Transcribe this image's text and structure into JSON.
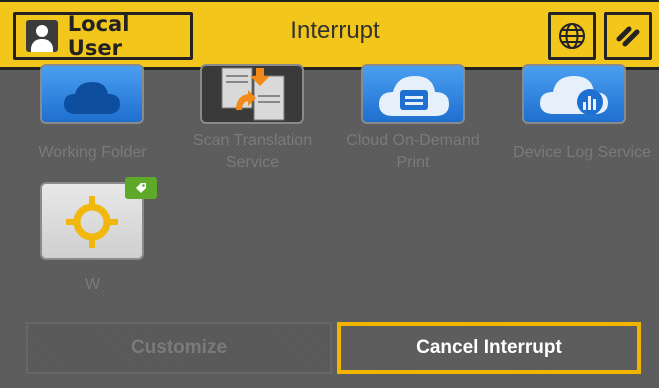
{
  "header": {
    "user_label": "Local User",
    "title": "Interrupt",
    "language_icon": "globe-icon",
    "reset_icon": "reset-slash-icon"
  },
  "apps": [
    {
      "label": "Working Folder",
      "icon": "cloud-icon"
    },
    {
      "label_line1": "Scan Translation",
      "label_line2": "Service",
      "icon": "scan-translation-icon"
    },
    {
      "label_line1": "Cloud On-Demand",
      "label_line2": "Print",
      "icon": "cloud-print-icon"
    },
    {
      "label": "Device Log Service",
      "icon": "cloud-chart-icon"
    },
    {
      "label": "W",
      "icon": "crosshair-icon",
      "badge_icon": "tag-badge-icon"
    }
  ],
  "footer": {
    "customize_label": "Customize",
    "cancel_label": "Cancel Interrupt"
  },
  "colors": {
    "header_bg": "#f3c61b",
    "background": "#5b5b5b",
    "app_blue": "#2a7fe0",
    "cancel_border": "#f3b400",
    "crosshair": "#f2b70c",
    "badge": "#5fa92a"
  }
}
